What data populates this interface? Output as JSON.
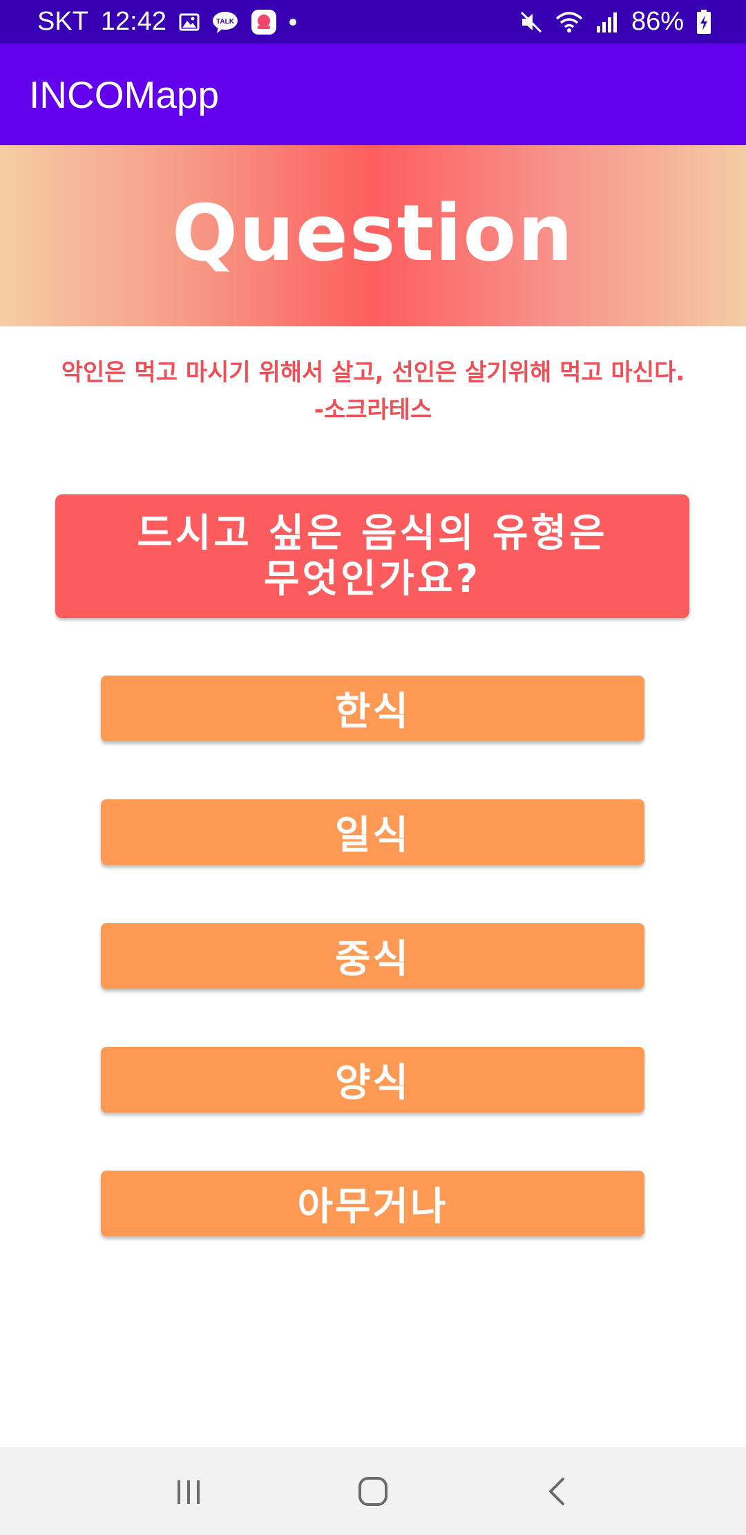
{
  "status_bar": {
    "carrier": "SKT",
    "time": "12:42",
    "battery": "86%",
    "icons": [
      "image-icon",
      "talk-icon",
      "notification-app-icon",
      "dot-icon",
      "mute-icon",
      "wifi-icon",
      "signal-icon",
      "battery-charging-icon"
    ]
  },
  "app_bar": {
    "title": "INCOMapp",
    "color": "#6200ee"
  },
  "banner": {
    "title": "Question"
  },
  "quote": {
    "line1": "악인은 먹고 마시기 위해서 살고, 선인은 살기위해 먹고 마신다.",
    "line2": "-소크라테스"
  },
  "question": {
    "line1": "드시고 싶은 음식의 유형은",
    "line2": "무엇인가요?"
  },
  "options": [
    {
      "label": "한식"
    },
    {
      "label": "일식"
    },
    {
      "label": "중식"
    },
    {
      "label": "양식"
    },
    {
      "label": "아무거나"
    }
  ],
  "nav_bar": {
    "icons": [
      "recent-apps-icon",
      "home-icon",
      "back-icon"
    ]
  },
  "colors": {
    "status_bar": "#3700b3",
    "question_box": "#fd5c5e",
    "option_button": "#ff9a55",
    "quote_text": "#ef4f56"
  }
}
